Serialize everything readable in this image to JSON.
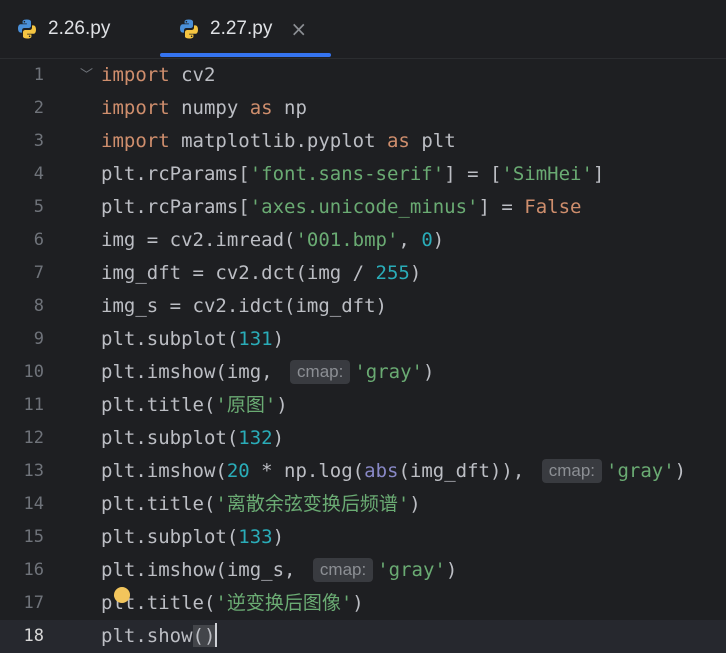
{
  "tabs": [
    {
      "label": "2.26.py",
      "active": false,
      "icon": "python-icon"
    },
    {
      "label": "2.27.py",
      "active": true,
      "icon": "python-icon",
      "close": "×"
    }
  ],
  "colors": {
    "background": "#1e1f22",
    "keyword": "#cf8e6d",
    "string": "#6aab73",
    "number": "#2aacb8",
    "builtin": "#8888c6",
    "accent": "#3574f0"
  },
  "editor": {
    "current_line": 18,
    "lines": [
      {
        "n": "1",
        "p": [
          "import",
          " cv2"
        ]
      },
      {
        "n": "2",
        "p": [
          "import",
          " numpy ",
          "as",
          " np"
        ]
      },
      {
        "n": "3",
        "p": [
          "import",
          " matplotlib.pyplot ",
          "as",
          " plt"
        ]
      },
      {
        "n": "4",
        "p": [
          "plt.rcParams[",
          "'font.sans-serif'",
          "] = [",
          "'SimHei'",
          "]"
        ]
      },
      {
        "n": "5",
        "p": [
          "plt.rcParams[",
          "'axes.unicode_minus'",
          "] = ",
          "False"
        ]
      },
      {
        "n": "6",
        "p": [
          "img = cv2.imread(",
          "'001.bmp'",
          ", ",
          "0",
          ")"
        ]
      },
      {
        "n": "7",
        "p": [
          "img_dft = cv2.dct(img / ",
          "255",
          ")"
        ]
      },
      {
        "n": "8",
        "p": [
          "img_s = cv2.idct(img_dft)"
        ]
      },
      {
        "n": "9",
        "p": [
          "plt.subplot(",
          "131",
          ")"
        ]
      },
      {
        "n": "10",
        "p": [
          "plt.imshow(img, ",
          "cmap:",
          "'gray'",
          ")"
        ]
      },
      {
        "n": "11",
        "p": [
          "plt.title(",
          "'原图'",
          ")"
        ]
      },
      {
        "n": "12",
        "p": [
          "plt.subplot(",
          "132",
          ")"
        ]
      },
      {
        "n": "13",
        "p": [
          "plt.imshow(",
          "20",
          " * np.log(",
          "abs",
          "(img_dft)), ",
          "cmap:",
          "'gray'",
          ")"
        ]
      },
      {
        "n": "14",
        "p": [
          "plt.title(",
          "'离散余弦变换后频谱'",
          ")"
        ]
      },
      {
        "n": "15",
        "p": [
          "plt.subplot(",
          "133",
          ")"
        ]
      },
      {
        "n": "16",
        "p": [
          "plt.imshow(img_s, ",
          "cmap:",
          "'gray'",
          ")"
        ]
      },
      {
        "n": "17",
        "p": [
          "plt.title(",
          "'逆变换后图像'",
          ")"
        ]
      },
      {
        "n": "18",
        "p": [
          "plt.show",
          "()"
        ]
      }
    ]
  }
}
